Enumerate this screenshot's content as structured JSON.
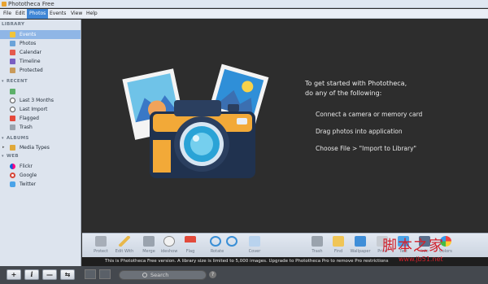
{
  "window": {
    "title": "Phototheca Free"
  },
  "menu": [
    "File",
    "Edit",
    "Photos",
    "Events",
    "View",
    "Help"
  ],
  "sidebar": {
    "library_header": "LIBRARY",
    "library": [
      "Events",
      "Photos",
      "Calendar",
      "Timeline",
      "Protected"
    ],
    "recent_header": "RECENT",
    "recent": [
      "Last 3 Months",
      "Last Import",
      "Flagged",
      "Trash"
    ],
    "albums_header": "ALBUMS",
    "albums": [
      "Media Types"
    ],
    "web_header": "WEB",
    "web": [
      "Flickr",
      "Google",
      "Twitter"
    ]
  },
  "welcome": {
    "title": "To get started with Phototheca,\ndo any of the following:",
    "hints": [
      "Connect a camera or memory card",
      "Drag photos into application",
      "Choose File > \"Import to Library\""
    ]
  },
  "toolbar": [
    "Protect",
    "Edit With",
    "Merge",
    "ideshow",
    "Flag",
    "Rotate",
    "Cover",
    "Trash",
    "Find",
    "Wallpaper",
    "Print",
    "Twit",
    "Info",
    "Colors"
  ],
  "info_bar": "This is Phototheca Free version. A library size is limited to 5,000 images. Upgrade to Phototheca Pro to remove Pro restrictions",
  "bottom": {
    "search_placeholder": "Search",
    "buttons": [
      "+",
      "i",
      "—",
      "⇆"
    ]
  },
  "watermark": {
    "line1": "脚本之家",
    "line2": "www.jb51.net"
  },
  "colors": {
    "accent": "#3f86d6",
    "selected": "#8fb6e6",
    "sidebar": "#dde4ee",
    "main": "#2d2d2d"
  }
}
